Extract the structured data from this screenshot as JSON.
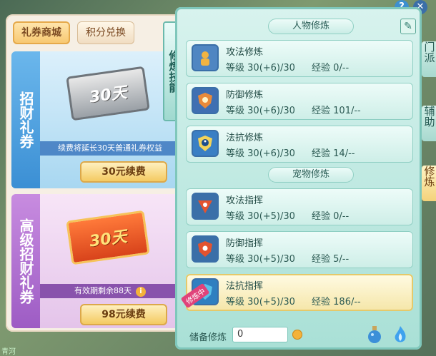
{
  "shop": {
    "tabs": [
      {
        "label": "礼券商城"
      },
      {
        "label": "积分兑换"
      }
    ],
    "cards": [
      {
        "side_label": "招财礼券",
        "ticket_text": "30天",
        "note": "续费将延长30天普通礼券权益",
        "button": "30元续费"
      },
      {
        "side_label": "高级招财礼券",
        "ticket_text": "30天",
        "note": "有效期剩余88天",
        "button": "98元续费"
      }
    ]
  },
  "cultivation": {
    "vertical_tab": "修炼技能",
    "person_section": "人物修炼",
    "pet_section": "宠物修炼",
    "lvl_prefix": "等级",
    "exp_prefix": "经验",
    "rows": [
      {
        "name": "攻法修炼",
        "level": "30(+6)/30",
        "exp": "0/--",
        "icon": "fist-icon",
        "active": false
      },
      {
        "name": "防御修炼",
        "level": "30(+6)/30",
        "exp": "101/--",
        "icon": "shield-icon",
        "active": false
      },
      {
        "name": "法抗修炼",
        "level": "30(+6)/30",
        "exp": "14/--",
        "icon": "taiji-shield-icon",
        "active": false
      },
      {
        "name": "攻法指挥",
        "level": "30(+5)/30",
        "exp": "0/--",
        "icon": "paw-attack-icon",
        "active": false
      },
      {
        "name": "防御指挥",
        "level": "30(+5)/30",
        "exp": "5/--",
        "icon": "paw-shield-icon",
        "active": false
      },
      {
        "name": "法抗指挥",
        "level": "30(+5)/30",
        "exp": "186/--",
        "icon": "paw-magic-icon",
        "active": true,
        "badge": "修炼中"
      }
    ],
    "reserve_label": "储备修炼",
    "reserve_value": "0"
  },
  "side_nav": [
    {
      "label": "门派"
    },
    {
      "label": "辅助"
    },
    {
      "label": "修炼"
    }
  ],
  "corner_text": "青河"
}
